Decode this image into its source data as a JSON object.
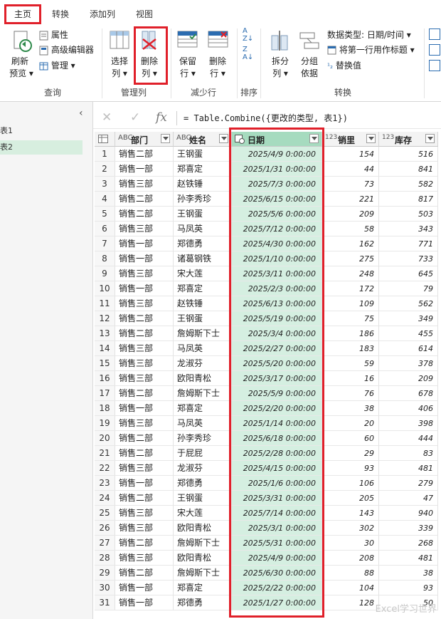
{
  "ribbon": {
    "tabs": [
      "主页",
      "转换",
      "添加列",
      "视图"
    ],
    "query_group": {
      "refresh_label_1": "刷新",
      "refresh_label_2": "预览",
      "properties": "属性",
      "advanced_editor": "高级编辑器",
      "manage": "管理",
      "group_label": "查询"
    },
    "manage_columns_group": {
      "choose_1": "选择",
      "choose_2": "列",
      "remove_1": "删除",
      "remove_2": "列",
      "group_label": "管理列"
    },
    "reduce_rows_group": {
      "keep_1": "保留",
      "keep_2": "行",
      "remove_1": "删除",
      "remove_2": "行",
      "group_label": "减少行"
    },
    "sort_group": {
      "group_label": "排序"
    },
    "transform_group": {
      "split_1": "拆分",
      "split_2": "列",
      "groupby_1": "分组",
      "groupby_2": "依据",
      "data_type": "数据类型: 日期/时间",
      "first_row_header": "将第一行用作标题",
      "replace_values": "替换值",
      "group_label": "转换"
    }
  },
  "queries": [
    {
      "label": "表1",
      "selected": false
    },
    {
      "label": "表2",
      "selected": true
    }
  ],
  "formula": "= Table.Combine({更改的类型, 表1})",
  "columns": [
    {
      "type_icon": "ABC",
      "name": "部门"
    },
    {
      "type_icon": "ABC",
      "name": "姓名"
    },
    {
      "type_icon": "datetime",
      "name": "日期"
    },
    {
      "type_icon": "123",
      "name": "销里"
    },
    {
      "type_icon": "123",
      "name": "库存"
    }
  ],
  "rows": [
    [
      "销售二部",
      "王钢蛋",
      "2025/4/9 0:00:00",
      "154",
      "516"
    ],
    [
      "销售一部",
      "郑喜定",
      "2025/1/31 0:00:00",
      "44",
      "841"
    ],
    [
      "销售三部",
      "赵铁锤",
      "2025/7/3 0:00:00",
      "73",
      "582"
    ],
    [
      "销售二部",
      "孙李秀珍",
      "2025/6/15 0:00:00",
      "221",
      "817"
    ],
    [
      "销售二部",
      "王钢蛋",
      "2025/5/6 0:00:00",
      "209",
      "503"
    ],
    [
      "销售三部",
      "马凤英",
      "2025/7/12 0:00:00",
      "58",
      "343"
    ],
    [
      "销售一部",
      "郑德勇",
      "2025/4/30 0:00:00",
      "162",
      "771"
    ],
    [
      "销售一部",
      "诸葛钢铁",
      "2025/1/10 0:00:00",
      "275",
      "733"
    ],
    [
      "销售三部",
      "宋大莲",
      "2025/3/11 0:00:00",
      "248",
      "645"
    ],
    [
      "销售一部",
      "郑喜定",
      "2025/2/3 0:00:00",
      "172",
      "79"
    ],
    [
      "销售三部",
      "赵铁锤",
      "2025/6/13 0:00:00",
      "109",
      "562"
    ],
    [
      "销售二部",
      "王钢蛋",
      "2025/5/19 0:00:00",
      "75",
      "349"
    ],
    [
      "销售二部",
      "詹姆斯下士",
      "2025/3/4 0:00:00",
      "186",
      "455"
    ],
    [
      "销售三部",
      "马凤英",
      "2025/2/27 0:00:00",
      "183",
      "614"
    ],
    [
      "销售三部",
      "龙淑芬",
      "2025/5/20 0:00:00",
      "59",
      "378"
    ],
    [
      "销售三部",
      "欧阳青松",
      "2025/3/17 0:00:00",
      "16",
      "209"
    ],
    [
      "销售二部",
      "詹姆斯下士",
      "2025/5/9 0:00:00",
      "76",
      "678"
    ],
    [
      "销售一部",
      "郑喜定",
      "2025/2/20 0:00:00",
      "38",
      "406"
    ],
    [
      "销售三部",
      "马凤英",
      "2025/1/14 0:00:00",
      "20",
      "398"
    ],
    [
      "销售二部",
      "孙李秀珍",
      "2025/6/18 0:00:00",
      "60",
      "444"
    ],
    [
      "销售二部",
      "于屁屁",
      "2025/2/28 0:00:00",
      "29",
      "83"
    ],
    [
      "销售三部",
      "龙淑芬",
      "2025/4/15 0:00:00",
      "93",
      "481"
    ],
    [
      "销售一部",
      "郑德勇",
      "2025/1/6 0:00:00",
      "106",
      "279"
    ],
    [
      "销售二部",
      "王钢蛋",
      "2025/3/31 0:00:00",
      "205",
      "47"
    ],
    [
      "销售三部",
      "宋大莲",
      "2025/7/14 0:00:00",
      "143",
      "940"
    ],
    [
      "销售三部",
      "欧阳青松",
      "2025/3/1 0:00:00",
      "302",
      "339"
    ],
    [
      "销售二部",
      "詹姆斯下士",
      "2025/5/31 0:00:00",
      "30",
      "268"
    ],
    [
      "销售三部",
      "欧阳青松",
      "2025/4/9 0:00:00",
      "208",
      "481"
    ],
    [
      "销售二部",
      "詹姆斯下士",
      "2025/6/30 0:00:00",
      "88",
      "38"
    ],
    [
      "销售一部",
      "郑喜定",
      "2025/2/22 0:00:00",
      "104",
      "93"
    ],
    [
      "销售一部",
      "郑德勇",
      "2025/1/27 0:00:00",
      "128",
      "50"
    ]
  ],
  "watermark": "Excel学习世界",
  "colors": {
    "highlight_red": "#e0202a",
    "date_column_bg": "#d5efe1",
    "date_header_bg": "#a6dbbf",
    "selected_query_bg": "#d7eedf"
  }
}
